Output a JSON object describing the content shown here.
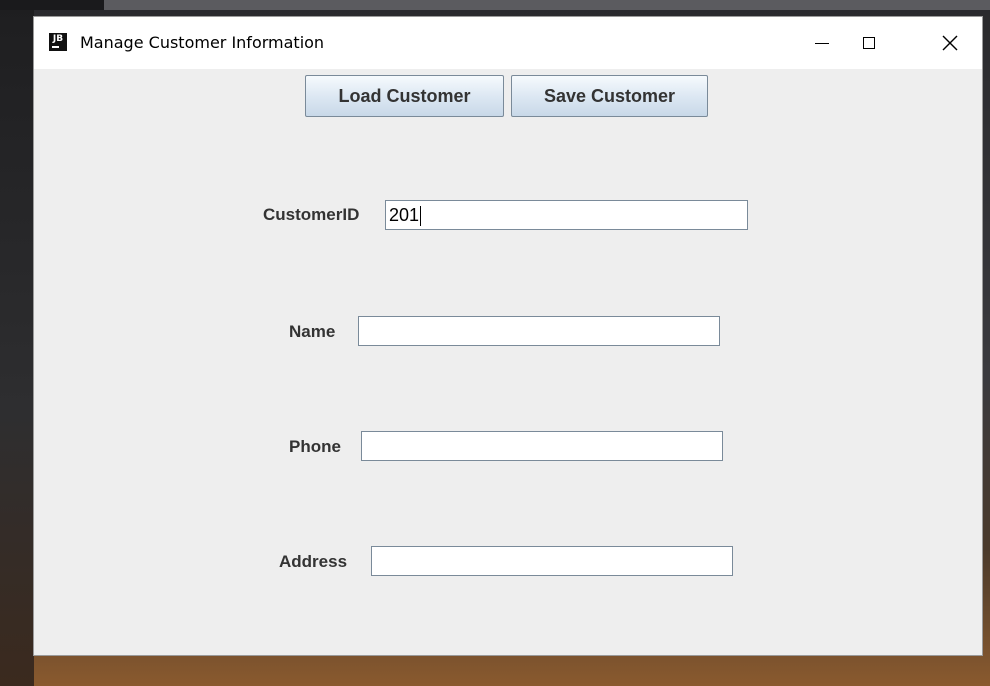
{
  "window": {
    "title": "Manage Customer Information",
    "app_icon_text": "JB"
  },
  "toolbar": {
    "load_label": "Load Customer",
    "save_label": "Save Customer"
  },
  "form": {
    "customer_id_label": "CustomerID",
    "customer_id_value": "201",
    "name_label": "Name",
    "name_value": "",
    "phone_label": "Phone",
    "phone_value": "",
    "address_label": "Address",
    "address_value": ""
  },
  "icons": {
    "minimize": "minimize-icon",
    "maximize": "maximize-icon",
    "close": "close-icon"
  }
}
